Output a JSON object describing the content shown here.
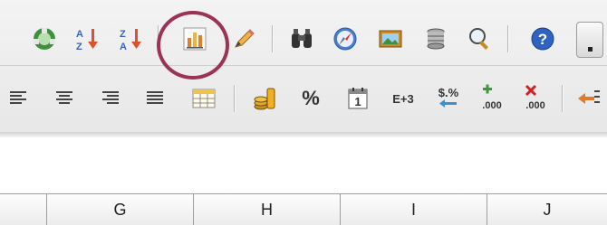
{
  "toolbar": {
    "standard_row": [
      {
        "name": "recycle-icon",
        "label": "Recycle"
      },
      {
        "name": "sort-ascending-icon",
        "label": "Sort Ascending"
      },
      {
        "name": "sort-descending-icon",
        "label": "Sort Descending"
      },
      {
        "name": "chart-icon",
        "label": "Chart"
      },
      {
        "name": "draw-functions-icon",
        "label": "Draw Functions"
      },
      {
        "name": "find-replace-icon",
        "label": "Find & Replace"
      },
      {
        "name": "navigator-icon",
        "label": "Navigator"
      },
      {
        "name": "gallery-icon",
        "label": "Gallery"
      },
      {
        "name": "data-sources-icon",
        "label": "Data Sources"
      },
      {
        "name": "zoom-icon",
        "label": "Zoom"
      },
      {
        "name": "help-icon",
        "label": "Help"
      }
    ],
    "formatting_row": [
      {
        "name": "align-left-icon",
        "label": "Align Left"
      },
      {
        "name": "align-center-icon",
        "label": "Align Center"
      },
      {
        "name": "align-right-icon",
        "label": "Align Right"
      },
      {
        "name": "justify-icon",
        "label": "Justify"
      },
      {
        "name": "merge-cells-icon",
        "label": "Merge Cells"
      },
      {
        "name": "currency-format-icon",
        "label": "Number Format: Currency"
      },
      {
        "name": "percent-format-icon",
        "label": "Number Format: Percent",
        "text": "%"
      },
      {
        "name": "date-format-icon",
        "label": "Number Format: Date",
        "text": "1"
      },
      {
        "name": "scientific-format-icon",
        "label": "Number Format: Scientific",
        "text": "E+3"
      },
      {
        "name": "standard-format-icon",
        "label": "Number Format: Standard",
        "text": "$.%"
      },
      {
        "name": "add-decimal-icon",
        "label": "Add Decimal Place",
        "text": ".000"
      },
      {
        "name": "delete-decimal-icon",
        "label": "Delete Decimal Place",
        "text": ".000"
      },
      {
        "name": "decrease-indent-icon",
        "label": "Decrease Indent"
      }
    ],
    "highlighted": "chart-icon",
    "highlight_color": "#9c3357"
  },
  "sheet": {
    "column_headers": [
      "G",
      "H",
      "I",
      "J"
    ]
  }
}
